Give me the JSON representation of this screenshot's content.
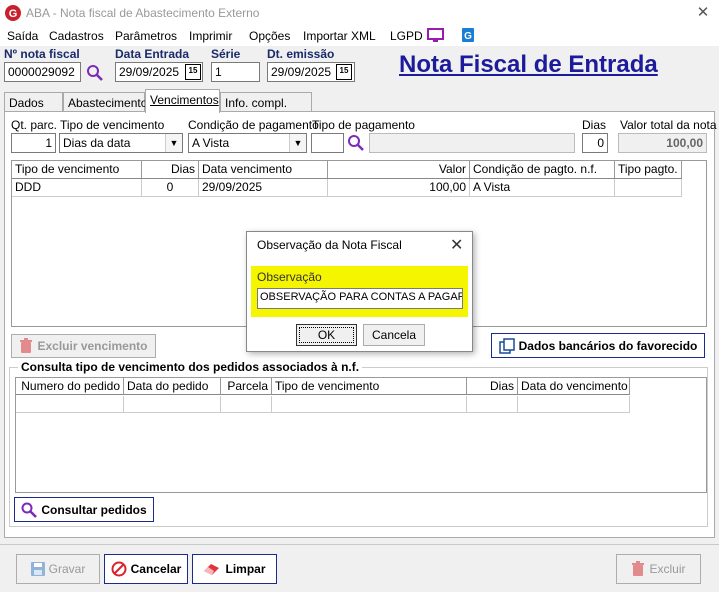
{
  "window": {
    "title": "ABA - Nota fiscal de Abastecimento Externo"
  },
  "menu": {
    "items": [
      "Saída",
      "Cadastros",
      "Parâmetros",
      "Imprimir",
      "Opções",
      "Importar XML",
      "LGPD"
    ]
  },
  "header": {
    "nota_label": "Nº nota fiscal",
    "nota_value": "0000029092",
    "entrada_label": "Data Entrada",
    "entrada_value": "29/09/2025",
    "serie_label": "Série",
    "serie_value": "1",
    "emissao_label": "Dt. emissão",
    "emissao_value": "29/09/2025",
    "calendar_glyph": "15",
    "big_title": "Nota Fiscal de Entrada"
  },
  "tabs": [
    "Dados NF",
    "Abastecimento",
    "Vencimentos",
    "Info. compl. Sped"
  ],
  "vencimentos": {
    "qt_label": "Qt. parc.",
    "qt_value": "1",
    "tipo_label": "Tipo de vencimento",
    "tipo_value": "Dias da data",
    "cond_label": "Condição de pagamento",
    "cond_value": "A Vista",
    "tipopag_label": "Tipo de pagamento",
    "tipopag_value": "",
    "dias_label": "Dias",
    "dias_value": "0",
    "total_label": "Valor total da nota",
    "total_value": "100,00",
    "grid_headers": [
      "Tipo de vencimento",
      "Dias",
      "Data vencimento",
      "Valor",
      "Condição de pagto. n.f.",
      "Tipo pagto."
    ],
    "grid_row": [
      "DDD",
      "0",
      "29/09/2025",
      "100,00",
      "A Vista",
      ""
    ],
    "excluir_label": "Excluir vencimento",
    "dados_bancarios_label": "Dados bancários do favorecido"
  },
  "consulta": {
    "title": "Consulta tipo de vencimento dos pedidos associados à n.f.",
    "headers": [
      "Numero do pedido",
      "Data do pedido",
      "Parcela",
      "Tipo de vencimento",
      "Dias",
      "Data do vencimento"
    ],
    "button_label": "Consultar pedidos"
  },
  "footer": {
    "gravar": "Gravar",
    "cancelar": "Cancelar",
    "limpar": "Limpar",
    "excluir": "Excluir"
  },
  "dialog": {
    "title": "Observação da Nota Fiscal",
    "field_label": "Observação",
    "field_value": "OBSERVAÇÃO PARA CONTAS A PAGAR",
    "ok": "OK",
    "cancel": "Cancela"
  },
  "colors": {
    "accent": "#1b1b9b",
    "highlight": "#f5f500",
    "danger": "#d9232d"
  }
}
